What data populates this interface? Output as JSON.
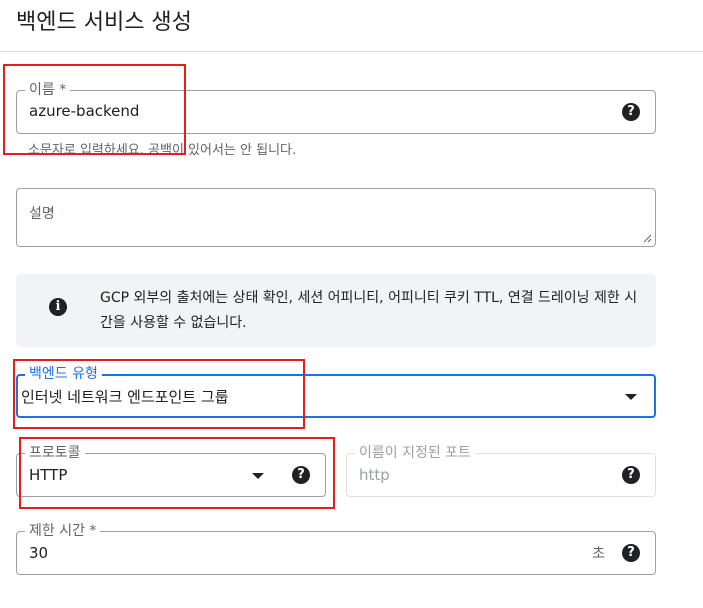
{
  "page": {
    "title": "백엔드 서비스 생성"
  },
  "name_field": {
    "label": "이름 *",
    "value": "azure-backend",
    "hint": "소문자로 입력하세요. 공백이 있어서는 안 됩니다.",
    "help_icon": "?"
  },
  "description_field": {
    "label": "설명",
    "value": ""
  },
  "info": {
    "icon": "i",
    "text": "GCP 외부의 출처에는 상태 확인, 세션 어피니티, 어피니티 쿠키 TTL, 연결 드레이닝 제한 시간을 사용할 수 없습니다."
  },
  "backend_type": {
    "label": "백엔드 유형",
    "value": "인터넷 네트워크 엔드포인트 그룹"
  },
  "protocol": {
    "label": "프로토콜",
    "value": "HTTP",
    "help_icon": "?"
  },
  "named_port": {
    "label": "이름이 지정된 포트",
    "placeholder": "http",
    "help_icon": "?"
  },
  "timeout": {
    "label": "제한 시간 *",
    "value": "30",
    "unit": "초",
    "help_icon": "?"
  },
  "colors": {
    "accent": "#1a73e8",
    "highlight": "#e41e1e"
  }
}
